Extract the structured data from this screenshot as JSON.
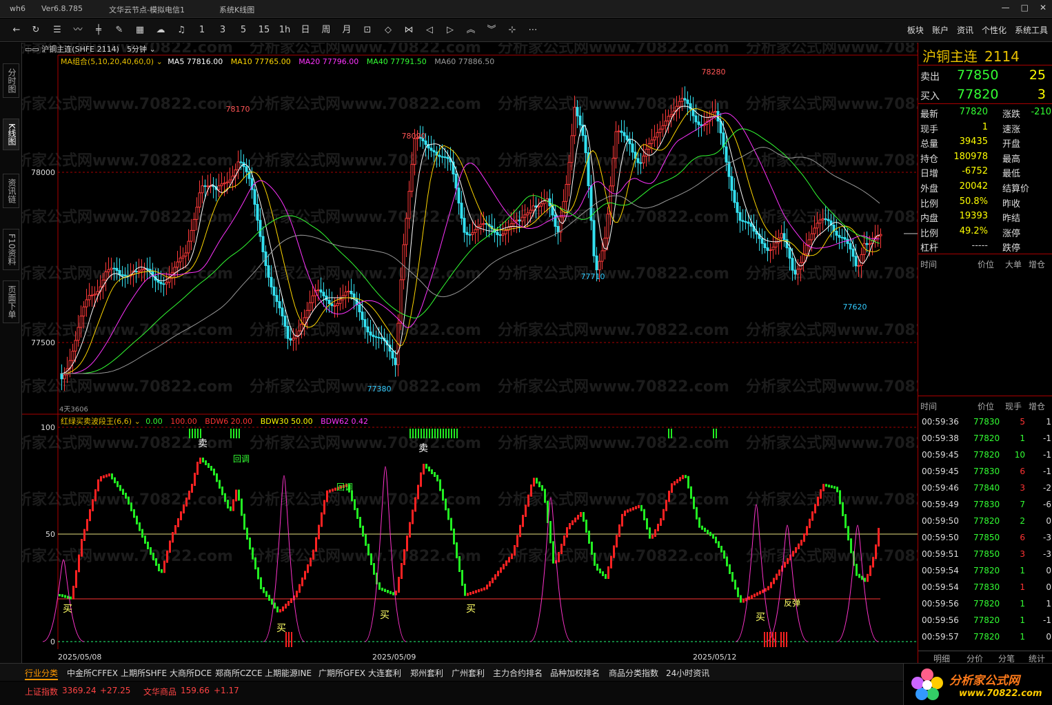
{
  "window": {
    "app": "wh6",
    "version": "Ver6.8.785",
    "server": "文华云节点-模拟电信1",
    "view": "系统K线图",
    "controls": [
      "—",
      "□",
      "✕"
    ]
  },
  "toolbar": {
    "period_buttons": [
      "1",
      "3",
      "5",
      "15",
      "1h",
      "日",
      "周",
      "月"
    ],
    "menu": [
      "板块",
      "账户",
      "资讯",
      "个性化",
      "系统工具"
    ]
  },
  "left_tabs": [
    "分时图",
    "K线图",
    "资讯链",
    "F10资料",
    "页面下单"
  ],
  "chart_header": {
    "symbol": "沪铜主连(SHFE 2114)",
    "period": "5分钟"
  },
  "ma_legend": {
    "group": "MA组合(5,10,20,40,60,0)",
    "items": [
      {
        "label": "MA5 77816.00",
        "color": "#ffffff"
      },
      {
        "label": "MA10 77765.00",
        "color": "#ffd700"
      },
      {
        "label": "MA20 77796.00",
        "color": "#ff33ff"
      },
      {
        "label": "MA40 77791.50",
        "color": "#33ff33"
      },
      {
        "label": "MA60 77886.50",
        "color": "#999999"
      }
    ]
  },
  "indicator_legend": {
    "name": "红绿买卖波段王(6,6)",
    "items": [
      {
        "label": "0.00",
        "color": "#33ff33"
      },
      {
        "label": "100.00",
        "color": "#ff3333"
      },
      {
        "label": "BDW6 20.00",
        "color": "#ff3333"
      },
      {
        "label": "BDW30 50.00",
        "color": "#ffff00"
      },
      {
        "label": "BDW62 0.42",
        "color": "#ff33ff"
      }
    ]
  },
  "chart_data": {
    "type": "candlestick",
    "price_axis_labels": [
      "78000",
      "77500"
    ],
    "price_ylim": [
      77230,
      78350
    ],
    "annotations": [
      {
        "text": "78170",
        "price": 78170
      },
      {
        "text": "78090",
        "price": 78090
      },
      {
        "text": "78280",
        "price": 78280
      },
      {
        "text": "77380",
        "price": 77380
      },
      {
        "text": "77710",
        "price": 77710
      },
      {
        "text": "77620",
        "price": 77620
      }
    ],
    "indicator_axis_labels": [
      "100",
      "50",
      "0"
    ],
    "indicator_ylim": [
      0,
      100
    ],
    "dates": [
      "2025/05/08",
      "2025/05/09",
      "2025/05/12"
    ],
    "signals": [
      "卖",
      "回调",
      "卖",
      "回调",
      "买",
      "买",
      "买",
      "买",
      "买",
      "反弹"
    ],
    "lower_left_label": "4天3606"
  },
  "quote": {
    "name": "沪铜主连",
    "code": "2114",
    "sell_label": "卖出",
    "sell_price": "77850",
    "sell_vol": "25",
    "buy_label": "买入",
    "buy_price": "77820",
    "buy_vol": "3",
    "rows": [
      {
        "l1": "最新",
        "v1": "77820",
        "c1": "#33ff33",
        "l2": "涨跌",
        "v2": "-210",
        "c2": "#33ff33"
      },
      {
        "l1": "现手",
        "v1": "1",
        "c1": "#ffff00",
        "l2": "速涨",
        "v2": "",
        "c2": "#ccc"
      },
      {
        "l1": "总量",
        "v1": "39435",
        "c1": "#ffff00",
        "l2": "开盘",
        "v2": "",
        "c2": "#ccc"
      },
      {
        "l1": "持仓",
        "v1": "180978",
        "c1": "#ffff00",
        "l2": "最高",
        "v2": "",
        "c2": "#ccc"
      },
      {
        "l1": "日增",
        "v1": "-6752",
        "c1": "#ffff00",
        "l2": "最低",
        "v2": "",
        "c2": "#ccc"
      },
      {
        "l1": "外盘",
        "v1": "20042",
        "c1": "#ffff00",
        "l2": "结算价",
        "v2": "",
        "c2": "#ccc"
      },
      {
        "l1": "比例",
        "v1": "50.8%",
        "c1": "#ffff00",
        "l2": "昨收",
        "v2": "",
        "c2": "#ccc"
      },
      {
        "l1": "内盘",
        "v1": "19393",
        "c1": "#ffff00",
        "l2": "昨结",
        "v2": "",
        "c2": "#ccc"
      },
      {
        "l1": "比例",
        "v1": "49.2%",
        "c1": "#ffff00",
        "l2": "涨停",
        "v2": "",
        "c2": "#ccc"
      },
      {
        "l1": "杠杆",
        "v1": "-----",
        "c1": "#ccc",
        "l2": "跌停",
        "v2": "",
        "c2": "#ccc"
      }
    ],
    "section_headers": [
      "时间",
      "价位",
      "大单",
      "增仓"
    ],
    "tick_headers": [
      "时间",
      "价位",
      "现手",
      "增仓"
    ],
    "ticks": [
      {
        "t": "00:59:36",
        "p": "77830",
        "v": "5",
        "z": "1",
        "vc": "#ff3333"
      },
      {
        "t": "00:59:38",
        "p": "77820",
        "v": "1",
        "z": "-1",
        "vc": "#33ff33"
      },
      {
        "t": "00:59:45",
        "p": "77820",
        "v": "10",
        "z": "-1",
        "vc": "#33ff33"
      },
      {
        "t": "00:59:45",
        "p": "77830",
        "v": "6",
        "z": "-1",
        "vc": "#ff3333"
      },
      {
        "t": "00:59:46",
        "p": "77840",
        "v": "3",
        "z": "-2",
        "vc": "#ff3333"
      },
      {
        "t": "00:59:49",
        "p": "77830",
        "v": "7",
        "z": "-6",
        "vc": "#33ff33"
      },
      {
        "t": "00:59:50",
        "p": "77820",
        "v": "2",
        "z": "0",
        "vc": "#33ff33"
      },
      {
        "t": "00:59:50",
        "p": "77850",
        "v": "6",
        "z": "-3",
        "vc": "#ff3333"
      },
      {
        "t": "00:59:51",
        "p": "77850",
        "v": "3",
        "z": "-3",
        "vc": "#ff3333"
      },
      {
        "t": "00:59:54",
        "p": "77820",
        "v": "1",
        "z": "0",
        "vc": "#33ff33"
      },
      {
        "t": "00:59:54",
        "p": "77830",
        "v": "1",
        "z": "0",
        "vc": "#ff3333"
      },
      {
        "t": "00:59:56",
        "p": "77820",
        "v": "1",
        "z": "1",
        "vc": "#33ff33"
      },
      {
        "t": "00:59:56",
        "p": "77820",
        "v": "1",
        "z": "-1",
        "vc": "#33ff33"
      },
      {
        "t": "00:59:57",
        "p": "77820",
        "v": "1",
        "z": "0",
        "vc": "#33ff33"
      }
    ],
    "bottom_tabs": [
      "明细",
      "分价",
      "分笔",
      "统计"
    ]
  },
  "bottom_tabs": [
    "行业分类",
    "中金所CFFEX",
    "上期所SHFE",
    "大商所DCE",
    "郑商所CZCE",
    "上期能源INE",
    "广期所GFEX",
    "大连套利",
    "郑州套利",
    "广州套利",
    "主力合约排名",
    "品种加权排名",
    "商品分类指数",
    "24小时资讯"
  ],
  "status": {
    "index1_name": "上证指数",
    "index1_value": "3369.24",
    "index1_change": "+27.25",
    "index2_name": "文华商品",
    "index2_value": "159.66",
    "index2_change": "+1.17"
  },
  "watermark": {
    "brand": "分析家公式网",
    "url": "www.70822.com",
    "overlay": "分析家公式网www.70822.com"
  }
}
